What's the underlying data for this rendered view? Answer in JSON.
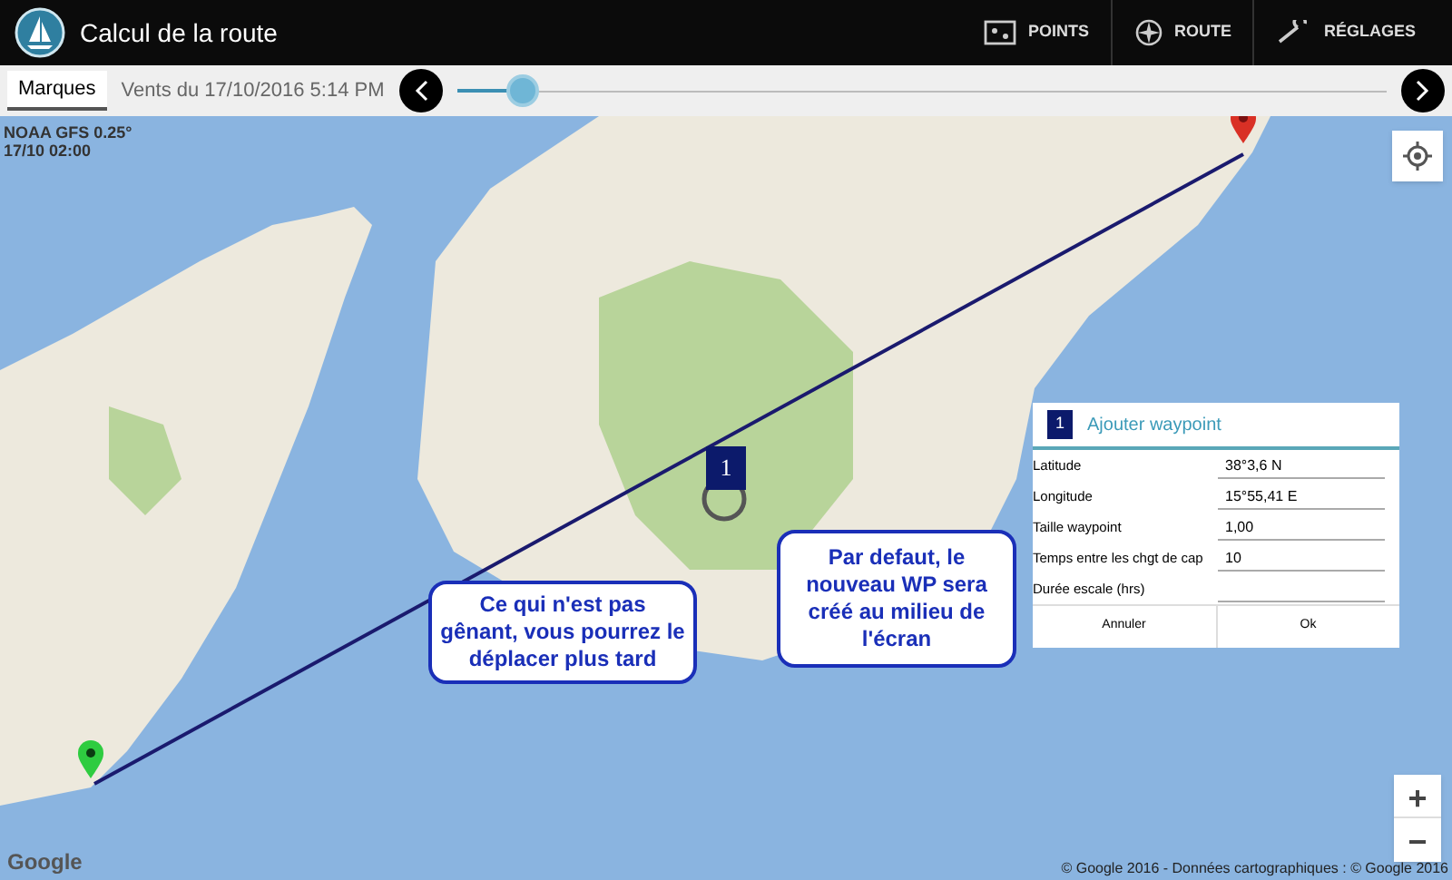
{
  "app_bar": {
    "title": "Calcul de la route",
    "actions": [
      {
        "kind": "points",
        "label": "POINTS"
      },
      {
        "kind": "route",
        "label": "ROUTE"
      },
      {
        "kind": "settings",
        "label": "RÉGLAGES"
      }
    ]
  },
  "toolbar": {
    "tab": {
      "label": "Marques",
      "selected": true
    },
    "wind_label": "Vents du 17/10/2016 5:14 PM",
    "slider": {
      "level": 0.07
    }
  },
  "map": {
    "model_line_1": "NOAA GFS 0.25°",
    "model_line_2": "17/10 02:00",
    "waypoint_number": "1",
    "google": "Google",
    "attribution": "© Google 2016 - Données cartographiques : © Google 2016",
    "zoom_in": "+",
    "zoom_out": "−"
  },
  "callouts": [
    {
      "text": "Ce qui n'est pas gênant, vous pourrez le déplacer plus tard"
    },
    {
      "text": "Par defaut, le nouveau WP sera créé au milieu de l'écran"
    }
  ],
  "dialog": {
    "badge": "1",
    "title": "Ajouter waypoint",
    "fields": [
      {
        "label": "Latitude",
        "value": "38°3,6 N"
      },
      {
        "label": "Longitude",
        "value": "15°55,41 E"
      },
      {
        "label": "Taille waypoint",
        "value": "1,00"
      },
      {
        "label": "Temps entre les chgt de cap",
        "value": "10"
      },
      {
        "label": "Durée escale (hrs)"
      }
    ],
    "buttons": [
      "Annuler",
      "Ok"
    ]
  }
}
